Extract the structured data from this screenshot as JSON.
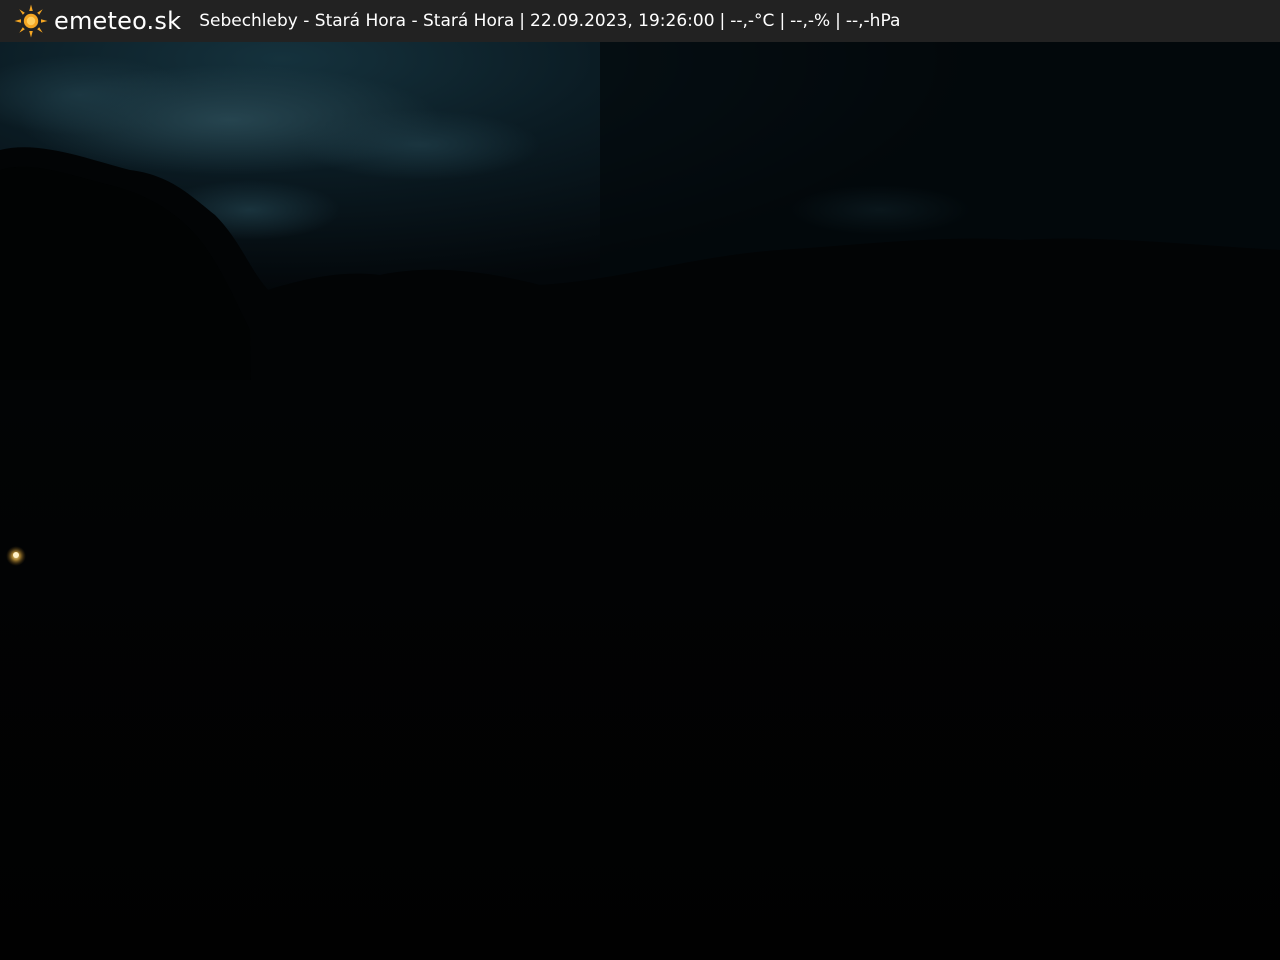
{
  "brand": {
    "logo_icon": "sun-icon",
    "name": "emeteo.sk",
    "accent_color": "#f5a623"
  },
  "caption": {
    "location": "Sebechleby - Stará Hora - Stará Hora",
    "separator": "|",
    "datetime": "22.09.2023, 19:26:00",
    "temperature": "--,-°C",
    "humidity": "--,-%",
    "pressure": "--,-hPa"
  },
  "colors": {
    "bar_background": "#222222",
    "text": "#ffffff",
    "sky": "#0a1a22"
  }
}
